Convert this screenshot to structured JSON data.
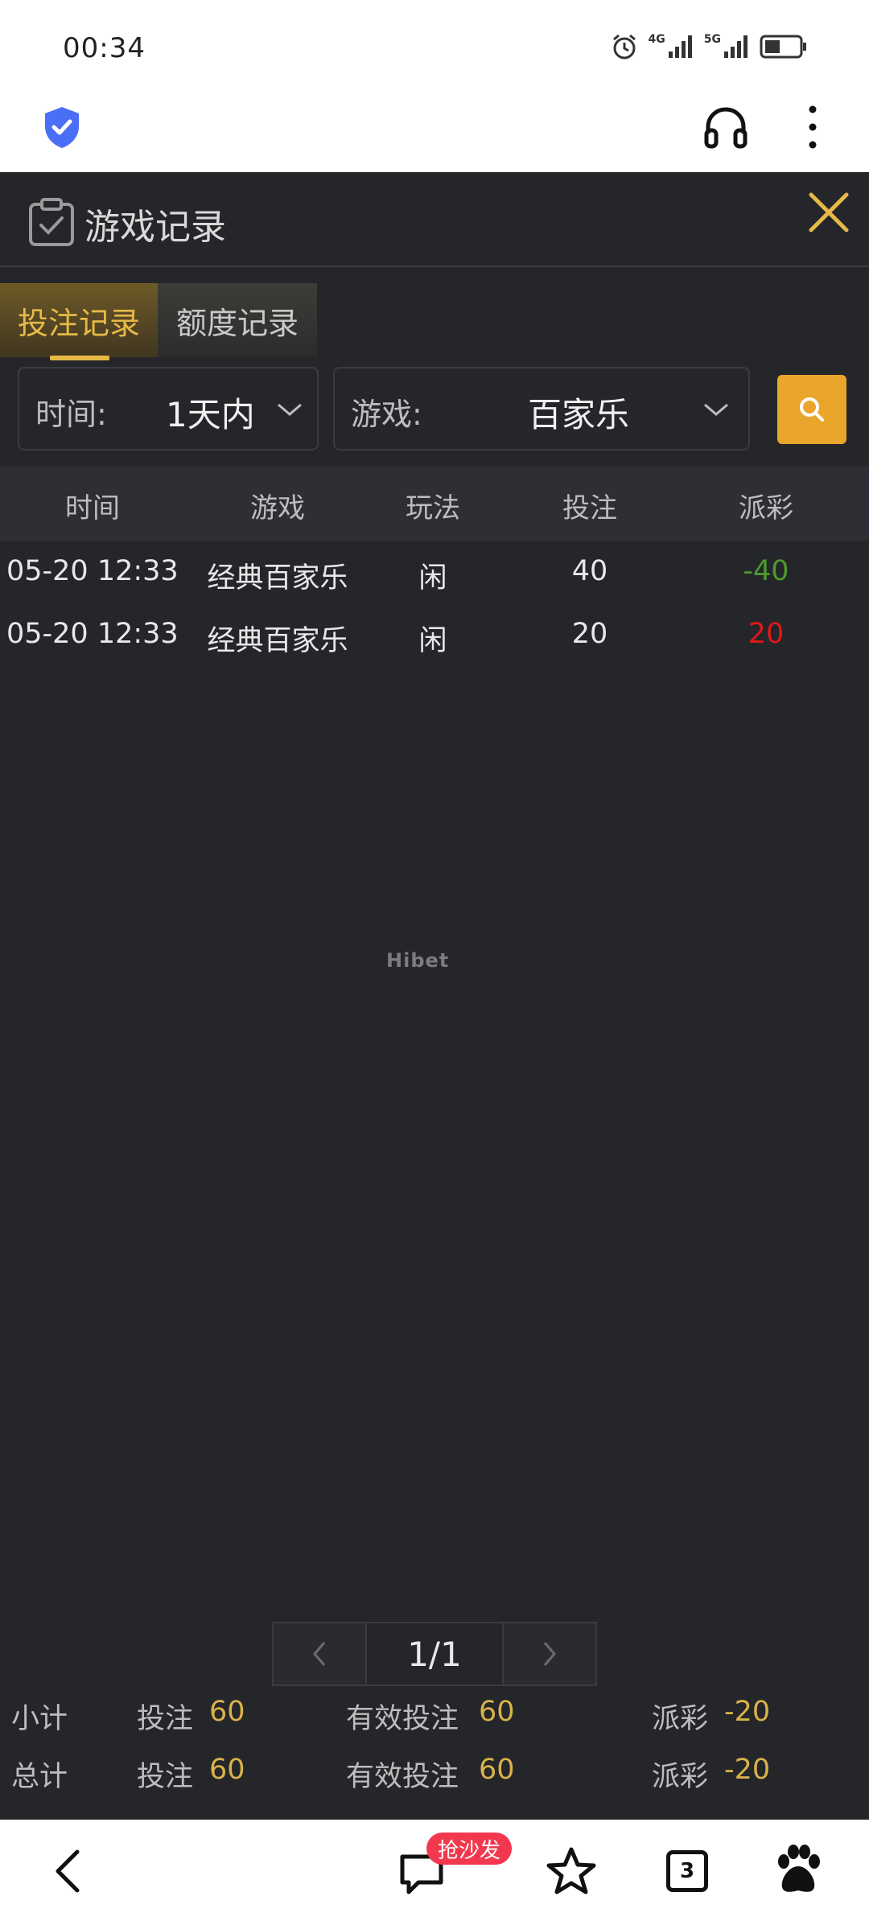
{
  "status_bar": {
    "time": "00:34",
    "net1": "4G",
    "net2": "5G"
  },
  "header": {
    "title": "游戏记录"
  },
  "tabs": [
    {
      "label": "投注记录",
      "active": true
    },
    {
      "label": "额度记录",
      "active": false
    }
  ],
  "filters": {
    "time": {
      "label": "时间:",
      "value": "1天内"
    },
    "game": {
      "label": "游戏:",
      "value": "百家乐"
    }
  },
  "table": {
    "headers": [
      "时间",
      "游戏",
      "玩法",
      "投注",
      "派彩"
    ],
    "rows": [
      {
        "time": "05-20 12:33",
        "game": "经典百家乐",
        "play": "闲",
        "bet": "40",
        "payout": "-40"
      },
      {
        "time": "05-20 12:33",
        "game": "经典百家乐",
        "play": "闲",
        "bet": "20",
        "payout": "20"
      }
    ]
  },
  "watermark": "Hibet",
  "pagination": {
    "label": "1/1"
  },
  "summary": {
    "subtotal": {
      "label": "小计",
      "bet_label": "投注",
      "bet": "60",
      "valid_label": "有效投注",
      "valid": "60",
      "payout_label": "派彩",
      "payout": "-20"
    },
    "total": {
      "label": "总计",
      "bet_label": "投注",
      "bet": "60",
      "valid_label": "有效投注",
      "valid": "60",
      "payout_label": "派彩",
      "payout": "-20"
    }
  },
  "bottom_nav": {
    "comment_badge": "抢沙发",
    "tab_count": "3"
  },
  "colors": {
    "accent": "#e6b947",
    "search_button": "#eaa52b",
    "negative": "#4e9a2e",
    "positive": "#e01818",
    "background": "#25262a"
  }
}
